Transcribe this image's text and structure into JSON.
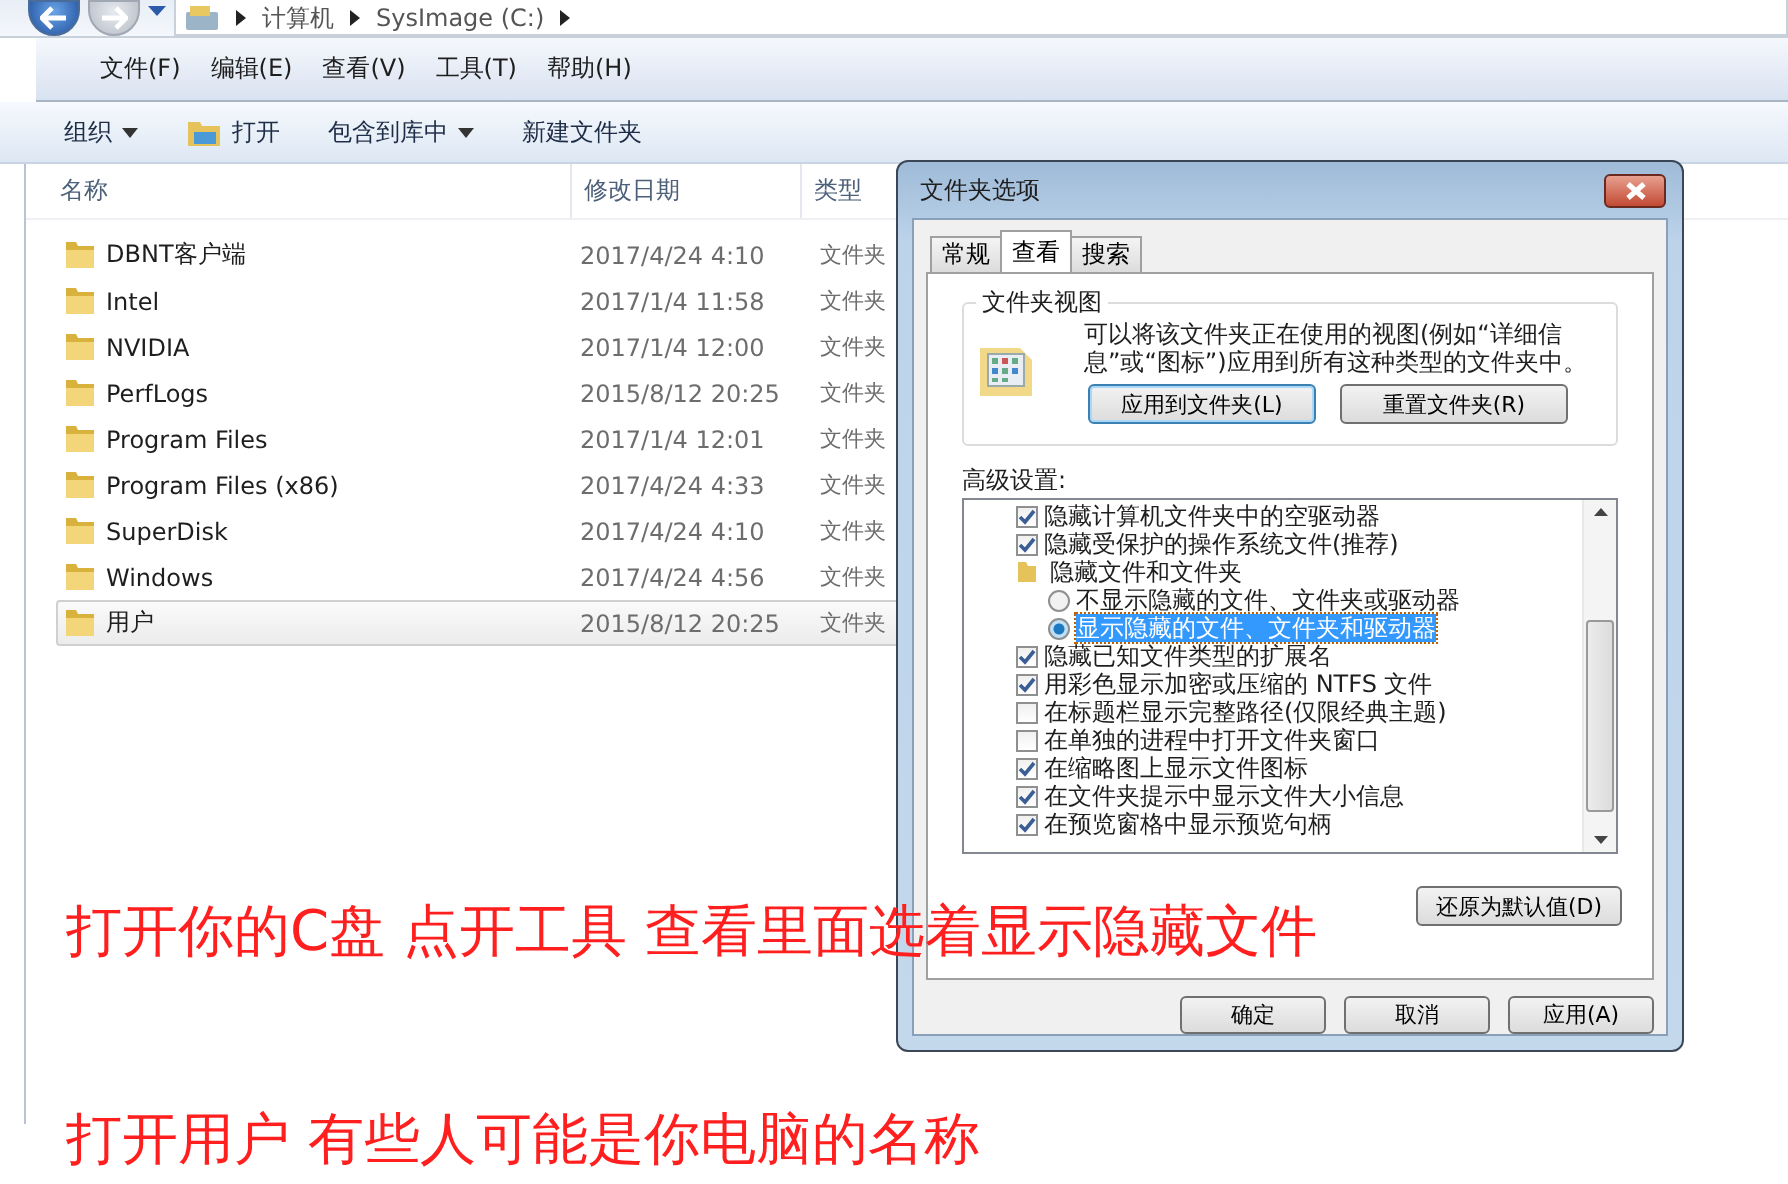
{
  "address_bar": {
    "path": [
      "计算机",
      "SysImage (C:)"
    ]
  },
  "menu": [
    "文件(F)",
    "编辑(E)",
    "查看(V)",
    "工具(T)",
    "帮助(H)"
  ],
  "toolbar": [
    {
      "label": "组织",
      "kind": "dropdown"
    },
    {
      "label": "打开",
      "kind": "open"
    },
    {
      "label": "包含到库中",
      "kind": "dropdown"
    },
    {
      "label": "新建文件夹",
      "kind": "plain"
    }
  ],
  "columns": [
    "名称",
    "修改日期",
    "类型"
  ],
  "files": [
    {
      "name": "DBNT客户端",
      "modified": "2017/4/24 4:10",
      "type": "文件夹",
      "selected": false
    },
    {
      "name": "Intel",
      "modified": "2017/1/4 11:58",
      "type": "文件夹",
      "selected": false
    },
    {
      "name": "NVIDIA",
      "modified": "2017/1/4 12:00",
      "type": "文件夹",
      "selected": false
    },
    {
      "name": "PerfLogs",
      "modified": "2015/8/12 20:25",
      "type": "文件夹",
      "selected": false
    },
    {
      "name": "Program Files",
      "modified": "2017/1/4 12:01",
      "type": "文件夹",
      "selected": false
    },
    {
      "name": "Program Files (x86)",
      "modified": "2017/4/24 4:33",
      "type": "文件夹",
      "selected": false
    },
    {
      "name": "SuperDisk",
      "modified": "2017/4/24 4:10",
      "type": "文件夹",
      "selected": false
    },
    {
      "name": "Windows",
      "modified": "2017/4/24 4:56",
      "type": "文件夹",
      "selected": false
    },
    {
      "name": "用户",
      "modified": "2015/8/12 20:25",
      "type": "文件夹",
      "selected": true
    }
  ],
  "dialog": {
    "title": "文件夹选项",
    "tabs": [
      {
        "label": "常规",
        "selected": false
      },
      {
        "label": "查看",
        "selected": true
      },
      {
        "label": "搜索",
        "selected": false
      }
    ],
    "folder_views": {
      "title": "文件夹视图",
      "description": "可以将该文件夹正在使用的视图(例如“详细信息”或“图标”)应用到所有这种类型的文件夹中。",
      "buttons": [
        {
          "label": "应用到文件夹(L)",
          "focused": true
        },
        {
          "label": "重置文件夹(R)",
          "focused": false
        }
      ]
    },
    "advanced": {
      "label": "高级设置:",
      "items": [
        {
          "kind": "checkbox",
          "label": "隐藏计算机文件夹中的空驱动器",
          "checked": true
        },
        {
          "kind": "checkbox",
          "label": "隐藏受保护的操作系统文件(推荐)",
          "checked": true
        },
        {
          "kind": "folder",
          "label": "隐藏文件和文件夹",
          "children": [
            {
              "kind": "radio",
              "label": "不显示隐藏的文件、文件夹或驱动器",
              "selected": false
            },
            {
              "kind": "radio",
              "label": "显示隐藏的文件、文件夹和驱动器",
              "selected": true
            }
          ]
        },
        {
          "kind": "checkbox",
          "label": "隐藏已知文件类型的扩展名",
          "checked": true
        },
        {
          "kind": "checkbox",
          "label": "用彩色显示加密或压缩的 NTFS 文件",
          "checked": true
        },
        {
          "kind": "checkbox",
          "label": "在标题栏显示完整路径(仅限经典主题)",
          "checked": false
        },
        {
          "kind": "checkbox",
          "label": "在单独的进程中打开文件夹窗口",
          "checked": false
        },
        {
          "kind": "checkbox",
          "label": "在缩略图上显示文件图标",
          "checked": true
        },
        {
          "kind": "checkbox",
          "label": "在文件夹提示中显示文件大小信息",
          "checked": true
        },
        {
          "kind": "checkbox",
          "label": "在预览窗格中显示预览句柄",
          "checked": true
        }
      ],
      "restore_button": "还原为默认值(D)"
    },
    "buttons": [
      "确定",
      "取消",
      "应用(A)"
    ]
  },
  "annotations": [
    "打开你的C盘 点开工具 查看里面选着显示隐藏文件",
    "打开用户 有些人可能是你电脑的名称"
  ]
}
